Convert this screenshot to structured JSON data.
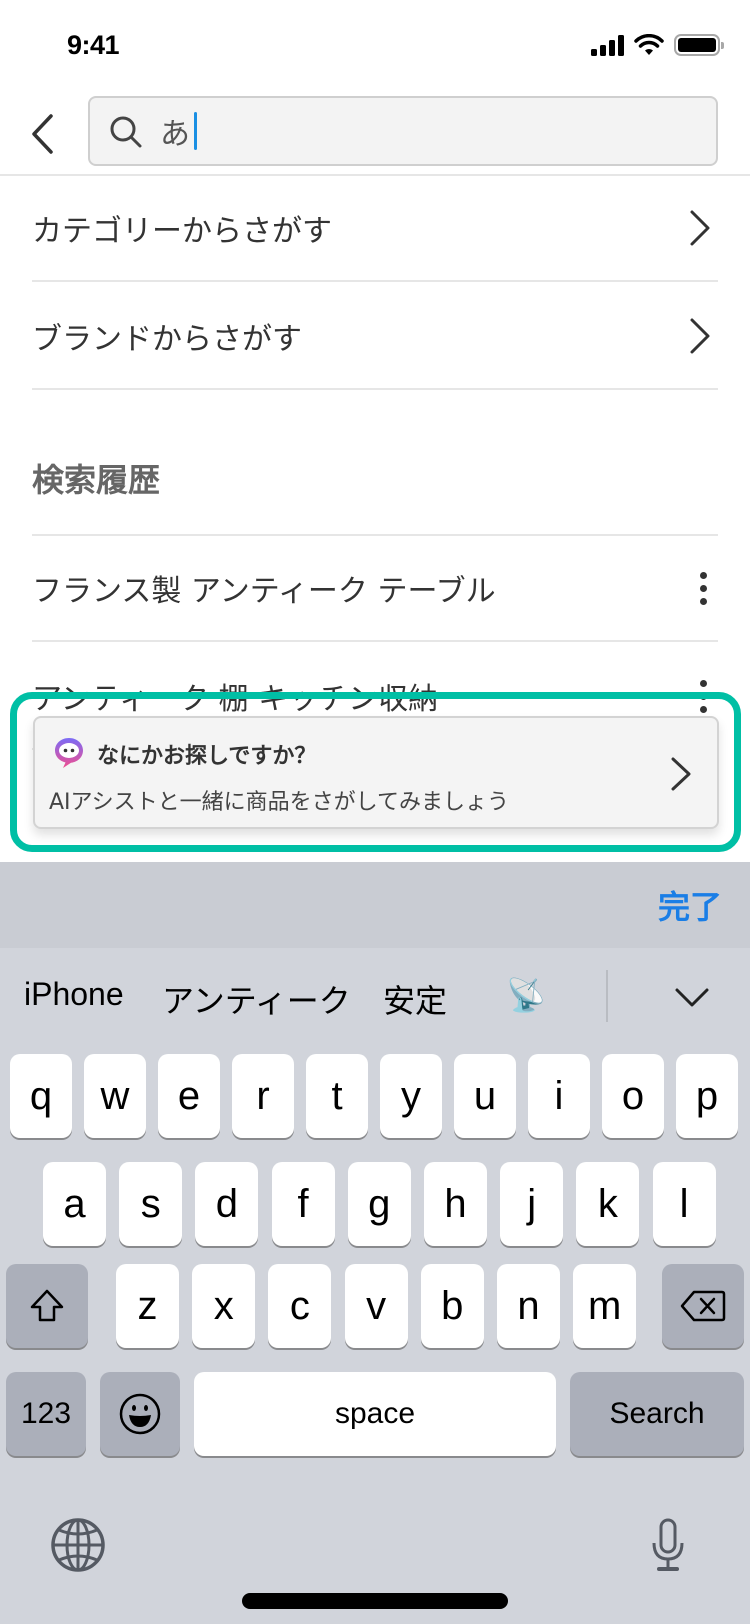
{
  "status_bar": {
    "time": "9:41",
    "icons": [
      "cellular-signal-icon",
      "wifi-icon",
      "battery-icon"
    ]
  },
  "search": {
    "back_icon": "chevron-left-icon",
    "search_icon": "magnifier-icon",
    "value": "あ",
    "placeholder": ""
  },
  "nav_items": [
    {
      "label": "カテゴリーからさがす",
      "icon": "chevron-right-icon"
    },
    {
      "label": "ブランドからさがす",
      "icon": "chevron-right-icon"
    }
  ],
  "history": {
    "title": "検索履歴",
    "items": [
      {
        "label": "フランス製 アンティーク テーブル",
        "icon": "more-vertical-icon"
      },
      {
        "label": "アンティーク 棚 キッチン収納",
        "icon": "more-vertical-icon"
      }
    ]
  },
  "ai_assist": {
    "icon": "ai-chat-bubble-icon",
    "title": "なにかお探しですか？",
    "subtitle": "AIアシストと一緒に商品をさがしてみましょう",
    "highlight_color": "#00bfa5"
  },
  "keyboard": {
    "done_label": "完了",
    "done_color": "#1a7ee6",
    "suggestions": [
      "iPhone",
      "アンティーク",
      "安定",
      "📡"
    ],
    "rows": [
      [
        "q",
        "w",
        "e",
        "r",
        "t",
        "y",
        "u",
        "i",
        "o",
        "p"
      ],
      [
        "a",
        "s",
        "d",
        "f",
        "g",
        "h",
        "j",
        "k",
        "l"
      ],
      [
        "z",
        "x",
        "c",
        "v",
        "b",
        "n",
        "m"
      ]
    ],
    "numbers_label": "123",
    "space_label": "space",
    "search_label": "Search"
  }
}
